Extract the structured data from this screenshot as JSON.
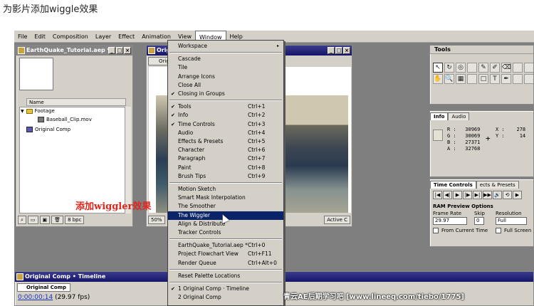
{
  "caption": "为影片添加wiggle效果",
  "menubar": [
    "File",
    "Edit",
    "Composition",
    "Layer",
    "Effect",
    "Animation",
    "View",
    "Window",
    "Help"
  ],
  "project": {
    "title": "EarthQuake_Tutorial.aep *",
    "column": "Name",
    "items": [
      {
        "label": "Footage",
        "type": "folder"
      },
      {
        "label": "Baseball_Clip.mov",
        "type": "clip"
      },
      {
        "label": "Original Comp",
        "type": "comp"
      }
    ],
    "bpc": "8 bpc"
  },
  "comp": {
    "title": "Origina",
    "tab": "Origina",
    "zoom": "50%",
    "view": "Active C"
  },
  "annotation": "添加wiggler效果",
  "window_menu": [
    {
      "label": "Workspace",
      "sub": "▸"
    },
    {
      "sep": true
    },
    {
      "label": "Cascade"
    },
    {
      "label": "Tile"
    },
    {
      "label": "Arrange Icons"
    },
    {
      "label": "Close All"
    },
    {
      "label": "Closing in Groups",
      "checked": true
    },
    {
      "sep": true
    },
    {
      "label": "Tools",
      "shortcut": "Ctrl+1",
      "checked": true
    },
    {
      "label": "Info",
      "shortcut": "Ctrl+2",
      "checked": true
    },
    {
      "label": "Time Controls",
      "shortcut": "Ctrl+3",
      "checked": true
    },
    {
      "label": "Audio",
      "shortcut": "Ctrl+4"
    },
    {
      "label": "Effects & Presets",
      "shortcut": "Ctrl+5"
    },
    {
      "label": "Character",
      "shortcut": "Ctrl+6"
    },
    {
      "label": "Paragraph",
      "shortcut": "Ctrl+7"
    },
    {
      "label": "Paint",
      "shortcut": "Ctrl+8"
    },
    {
      "label": "Brush Tips",
      "shortcut": "Ctrl+9"
    },
    {
      "sep": true
    },
    {
      "label": "Motion Sketch"
    },
    {
      "label": "Smart Mask Interpolation"
    },
    {
      "label": "The Smoother"
    },
    {
      "label": "The Wiggler",
      "highlight": true
    },
    {
      "label": "Align & Distribute"
    },
    {
      "label": "Tracker Controls"
    },
    {
      "sep": true
    },
    {
      "label": "EarthQuake_Tutorial.aep *",
      "shortcut": "Ctrl+0"
    },
    {
      "label": "Project Flowchart View",
      "shortcut": "Ctrl+F11"
    },
    {
      "label": "Render Queue",
      "shortcut": "Ctrl+Alt+0"
    },
    {
      "sep": true
    },
    {
      "label": "Reset Palette Locations"
    },
    {
      "sep": true
    },
    {
      "label": "1 Original Comp · Timeline",
      "checked": true
    },
    {
      "label": "2 Original Comp"
    }
  ],
  "tools": {
    "title": "Tools",
    "glyphs": [
      "↖",
      "↻",
      "◎",
      "",
      "✎",
      "✐",
      "⌫",
      "",
      "",
      "✋",
      "🔍",
      "▦",
      "",
      "□",
      "T",
      "✒",
      "",
      ""
    ]
  },
  "info": {
    "tabs": [
      "Info",
      "Audio"
    ],
    "rgba_block": "R :   30969\nG :   30069\nB :   27371\nA :   32768",
    "xy_block": "X :    278\nY :     14"
  },
  "time_controls": {
    "tabs": [
      "Time Controls",
      "ects & Presets"
    ],
    "buttons": [
      "|◀",
      "◀|",
      "▶",
      "|▶",
      "▶|",
      "▶▶",
      "🔊",
      "⟲",
      "▶"
    ],
    "ram_title": "RAM Preview Options",
    "frame_rate_label": "Frame Rate",
    "frame_rate": "29.97",
    "skip_label": "Skip",
    "skip": "0",
    "resolution_label": "Resolution",
    "resolution": "Full",
    "from_current": "From Current Time",
    "full_screen": "Full Screen"
  },
  "timeline": {
    "title": "Original Comp • Timeline",
    "tab": "Original Comp",
    "timecode": "0:00:00:14",
    "fps": "(29.97 fps)"
  },
  "watermark": "青云AE后期学习吧 [www.lineeq.com/tiebo/1775]"
}
